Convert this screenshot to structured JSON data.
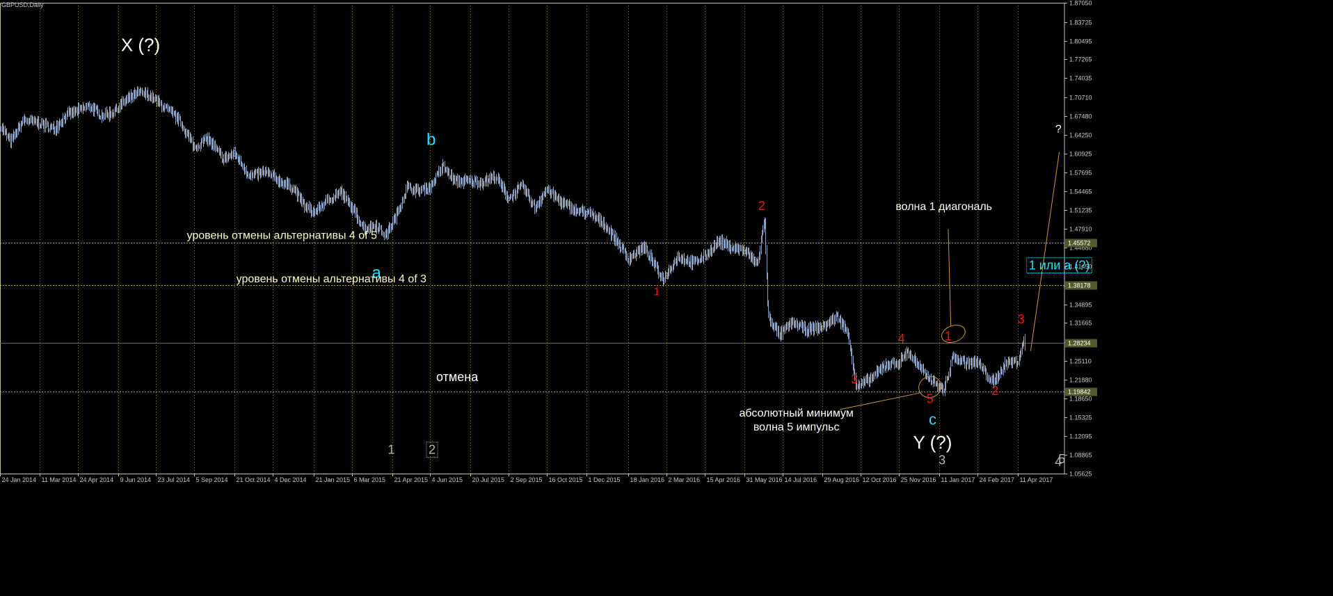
{
  "window": {
    "symbol_label": "GBPUSD,Daily"
  },
  "chart_data": {
    "type": "candlestick",
    "symbol": "GBPUSD",
    "timeframe": "Daily",
    "ylim": [
      1.05625,
      1.8705
    ],
    "xlim": [
      "2014-01-24",
      "2017-06-04"
    ],
    "y_ticks": [
      "1.87050",
      "1.83725",
      "1.80495",
      "1.77265",
      "1.74035",
      "1.70710",
      "1.67480",
      "1.64250",
      "1.60925",
      "1.57695",
      "1.54465",
      "1.51235",
      "1.47910",
      "1.44680",
      "1.41450",
      "1.38125",
      "1.34895",
      "1.31665",
      "1.28340",
      "1.25110",
      "1.21880",
      "1.18650",
      "1.15325",
      "1.12095",
      "1.08865",
      "1.05625"
    ],
    "x_ticks": [
      {
        "label": "24 Jan 2014",
        "date": "2014-01-24"
      },
      {
        "label": "11 Mar 2014",
        "date": "2014-03-11"
      },
      {
        "label": "24 Apr 2014",
        "date": "2014-04-24"
      },
      {
        "label": "9 Jun 2014",
        "date": "2014-06-09"
      },
      {
        "label": "23 Jul 2014",
        "date": "2014-07-23"
      },
      {
        "label": "5 Sep 2014",
        "date": "2014-09-05"
      },
      {
        "label": "21 Oct 2014",
        "date": "2014-10-21"
      },
      {
        "label": "4 Dec 2014",
        "date": "2014-12-04"
      },
      {
        "label": "21 Jan 2015",
        "date": "2015-01-21"
      },
      {
        "label": "6 Mar 2015",
        "date": "2015-03-06"
      },
      {
        "label": "21 Apr 2015",
        "date": "2015-04-21"
      },
      {
        "label": "4 Jun 2015",
        "date": "2015-06-04"
      },
      {
        "label": "20 Jul 2015",
        "date": "2015-07-20"
      },
      {
        "label": "2 Sep 2015",
        "date": "2015-09-02"
      },
      {
        "label": "16 Oct 2015",
        "date": "2015-10-16"
      },
      {
        "label": "1 Dec 2015",
        "date": "2015-12-01"
      },
      {
        "label": "18 Jan 2016",
        "date": "2016-01-18"
      },
      {
        "label": "2 Mar 2016",
        "date": "2016-03-02"
      },
      {
        "label": "15 Apr 2016",
        "date": "2016-04-15"
      },
      {
        "label": "31 May 2016",
        "date": "2016-05-31"
      },
      {
        "label": "14 Jul 2016",
        "date": "2016-07-14"
      },
      {
        "label": "29 Aug 2016",
        "date": "2016-08-29"
      },
      {
        "label": "12 Oct 2016",
        "date": "2016-10-12"
      },
      {
        "label": "25 Nov 2016",
        "date": "2016-11-25"
      },
      {
        "label": "11 Jan 2017",
        "date": "2017-01-11"
      },
      {
        "label": "24 Feb 2017",
        "date": "2017-02-24"
      },
      {
        "label": "11 Apr 2017",
        "date": "2017-04-11"
      }
    ],
    "series_path": [
      [
        "2014-01-24",
        1.658
      ],
      [
        "2014-02-05",
        1.63
      ],
      [
        "2014-02-20",
        1.668
      ],
      [
        "2014-03-11",
        1.662
      ],
      [
        "2014-03-27",
        1.652
      ],
      [
        "2014-04-10",
        1.676
      ],
      [
        "2014-04-24",
        1.684
      ],
      [
        "2014-05-07",
        1.692
      ],
      [
        "2014-05-20",
        1.676
      ],
      [
        "2014-06-02",
        1.68
      ],
      [
        "2014-06-18",
        1.702
      ],
      [
        "2014-07-03",
        1.715
      ],
      [
        "2014-07-15",
        1.71
      ],
      [
        "2014-08-01",
        1.69
      ],
      [
        "2014-08-18",
        1.668
      ],
      [
        "2014-09-05",
        1.62
      ],
      [
        "2014-09-20",
        1.636
      ],
      [
        "2014-10-08",
        1.6
      ],
      [
        "2014-10-21",
        1.61
      ],
      [
        "2014-11-08",
        1.57
      ],
      [
        "2014-11-25",
        1.578
      ],
      [
        "2014-12-10",
        1.564
      ],
      [
        "2014-12-28",
        1.55
      ],
      [
        "2015-01-10",
        1.518
      ],
      [
        "2015-01-21",
        1.508
      ],
      [
        "2015-02-05",
        1.528
      ],
      [
        "2015-02-20",
        1.544
      ],
      [
        "2015-03-06",
        1.514
      ],
      [
        "2015-03-20",
        1.48
      ],
      [
        "2015-04-02",
        1.486
      ],
      [
        "2015-04-13",
        1.468
      ],
      [
        "2015-04-25",
        1.5
      ],
      [
        "2015-05-08",
        1.552
      ],
      [
        "2015-05-20",
        1.545
      ],
      [
        "2015-06-04",
        1.552
      ],
      [
        "2015-06-18",
        1.588
      ],
      [
        "2015-07-02",
        1.562
      ],
      [
        "2015-07-20",
        1.562
      ],
      [
        "2015-08-01",
        1.56
      ],
      [
        "2015-08-18",
        1.57
      ],
      [
        "2015-09-02",
        1.532
      ],
      [
        "2015-09-18",
        1.554
      ],
      [
        "2015-10-02",
        1.516
      ],
      [
        "2015-10-16",
        1.548
      ],
      [
        "2015-11-01",
        1.526
      ],
      [
        "2015-11-20",
        1.51
      ],
      [
        "2015-12-01",
        1.508
      ],
      [
        "2015-12-20",
        1.49
      ],
      [
        "2016-01-05",
        1.458
      ],
      [
        "2016-01-18",
        1.428
      ],
      [
        "2016-02-05",
        1.448
      ],
      [
        "2016-02-27",
        1.392
      ],
      [
        "2016-03-15",
        1.432
      ],
      [
        "2016-04-01",
        1.42
      ],
      [
        "2016-04-15",
        1.432
      ],
      [
        "2016-05-01",
        1.458
      ],
      [
        "2016-05-15",
        1.448
      ],
      [
        "2016-05-31",
        1.442
      ],
      [
        "2016-06-15",
        1.418
      ],
      [
        "2016-06-23",
        1.5
      ],
      [
        "2016-06-27",
        1.33
      ],
      [
        "2016-07-10",
        1.295
      ],
      [
        "2016-07-25",
        1.318
      ],
      [
        "2016-08-10",
        1.305
      ],
      [
        "2016-08-29",
        1.31
      ],
      [
        "2016-09-15",
        1.328
      ],
      [
        "2016-09-28",
        1.296
      ],
      [
        "2016-10-07",
        1.205
      ],
      [
        "2016-10-25",
        1.222
      ],
      [
        "2016-11-10",
        1.245
      ],
      [
        "2016-11-25",
        1.248
      ],
      [
        "2016-12-05",
        1.268
      ],
      [
        "2016-12-20",
        1.236
      ],
      [
        "2016-12-30",
        1.222
      ],
      [
        "2017-01-16",
        1.2
      ],
      [
        "2017-01-26",
        1.258
      ],
      [
        "2017-02-10",
        1.248
      ],
      [
        "2017-02-24",
        1.248
      ],
      [
        "2017-03-14",
        1.212
      ],
      [
        "2017-03-28",
        1.248
      ],
      [
        "2017-04-11",
        1.25
      ],
      [
        "2017-04-18",
        1.285
      ],
      [
        "2017-04-20",
        1.278
      ]
    ],
    "horizontal_levels": [
      {
        "value": 1.45572,
        "label": "1.45572",
        "style": "dotted",
        "color": "#b8b840"
      },
      {
        "value": 1.38178,
        "label": "1.38178",
        "style": "dotted",
        "color": "#b8b840"
      },
      {
        "value": 1.28234,
        "label": "1.28234",
        "style": "solid",
        "color": "#6a6a6a"
      },
      {
        "value": 1.19842,
        "label": "1.19842",
        "style": "dotted",
        "color": "#b8b840"
      }
    ],
    "vertical_grid": "dotted",
    "colors": {
      "background": "#000000",
      "bars": "#8aa2c0",
      "grid": "#b8b840",
      "axis": "#c0c0c0",
      "wave_red": "#ff1010",
      "wave_cyan": "#22e0ff",
      "text_white": "#ffffff",
      "text_yellow": "#ffffc0",
      "text_gray": "#b4b4b4",
      "trendline": "#d09a3a",
      "price_tag": "#55582a"
    },
    "annotations": [
      {
        "id": "x-wave",
        "text": "X  (?)",
        "date": "2014-07-05",
        "value": 1.795,
        "color": "text_white",
        "size": 26
      },
      {
        "id": "b-wave",
        "text": "b",
        "date": "2015-06-05",
        "value": 1.632,
        "color": "wave_cyan",
        "size": 24
      },
      {
        "id": "a-wave",
        "text": "a",
        "date": "2015-04-03",
        "value": 1.402,
        "color": "wave_cyan",
        "size": 24
      },
      {
        "id": "level-4of5",
        "text": "уровень отмены альтернативы 4 of 5",
        "date": "2014-12-15",
        "value": 1.467,
        "color": "text_yellow",
        "size": 16
      },
      {
        "id": "level-4of3",
        "text": "уровень отмены альтернативы 4 of 3",
        "date": "2015-02-10",
        "value": 1.392,
        "color": "text_yellow",
        "size": 16
      },
      {
        "id": "otmena",
        "text": "отмена",
        "date": "2015-07-05",
        "value": 1.222,
        "color": "text_white",
        "size": 18
      },
      {
        "id": "red-1-main",
        "text": "1",
        "date": "2016-02-20",
        "value": 1.37,
        "color": "wave_red",
        "size": 16
      },
      {
        "id": "red-2-main",
        "text": "2",
        "date": "2016-06-20",
        "value": 1.518,
        "color": "wave_red",
        "size": 18
      },
      {
        "id": "red-3-low",
        "text": "3",
        "date": "2016-10-05",
        "value": 1.218,
        "color": "wave_red",
        "size": 18
      },
      {
        "id": "red-4",
        "text": "4",
        "date": "2016-11-28",
        "value": 1.288,
        "color": "wave_red",
        "size": 18
      },
      {
        "id": "red-5",
        "text": "5",
        "date": "2016-12-31",
        "value": 1.184,
        "color": "wave_red",
        "size": 18
      },
      {
        "id": "red-1-small",
        "text": "1",
        "date": "2017-01-21",
        "value": 1.292,
        "color": "wave_red",
        "size": 18
      },
      {
        "id": "red-2-small",
        "text": "2",
        "date": "2017-03-16",
        "value": 1.198,
        "color": "wave_red",
        "size": 18
      },
      {
        "id": "red-3-small",
        "text": "3",
        "date": "2017-04-15",
        "value": 1.322,
        "color": "wave_red",
        "size": 18
      },
      {
        "id": "c-wave",
        "text": "c",
        "date": "2017-01-03",
        "value": 1.148,
        "color": "wave_cyan",
        "size": 22
      },
      {
        "id": "y-wave",
        "text": "Y  (?)",
        "date": "2017-01-03",
        "value": 1.108,
        "color": "text_white",
        "size": 26
      },
      {
        "id": "abs-min-1",
        "text": "абсолютный минимум",
        "date": "2016-07-30",
        "value": 1.16,
        "color": "text_white",
        "size": 16
      },
      {
        "id": "abs-min-2",
        "text": "волна 5 импульс",
        "date": "2016-07-30",
        "value": 1.136,
        "color": "text_white",
        "size": 16
      },
      {
        "id": "diag-label",
        "text": "волна 1 диагональ",
        "date": "2017-01-16",
        "value": 1.517,
        "color": "text_white",
        "size": 16
      },
      {
        "id": "one-or-a",
        "text": "1 или а (?)",
        "date": "2017-05-29",
        "value": 1.415,
        "color": "wave_cyan",
        "size": 18,
        "boxed": true
      },
      {
        "id": "question",
        "text": "?",
        "date": "2017-05-28",
        "value": 1.651,
        "color": "text_white",
        "size": 16
      },
      {
        "id": "gray-1",
        "text": "1",
        "date": "2015-04-20",
        "value": 1.096,
        "color": "text_gray",
        "size": 18
      },
      {
        "id": "gray-2",
        "text": "2",
        "date": "2015-06-06",
        "value": 1.096,
        "color": "text_gray",
        "size": 18,
        "boxed": true
      },
      {
        "id": "gray-3",
        "text": "3",
        "date": "2017-01-14",
        "value": 1.078,
        "color": "text_gray",
        "size": 18
      },
      {
        "id": "gray-4",
        "text": "4",
        "date": "2017-05-28",
        "value": 1.075,
        "color": "text_gray",
        "size": 18
      },
      {
        "id": "gray-5",
        "text": "5",
        "date": "2017-06-01",
        "value": 1.08,
        "color": "text_gray",
        "size": 18
      }
    ],
    "ellipses": [
      {
        "id": "ellipse-1",
        "center": [
          "2017-01-27",
          1.298
        ],
        "rx_days": 14,
        "ry_value": 0.014,
        "color": "trendline"
      },
      {
        "id": "ellipse-5",
        "center": [
          "2016-12-31",
          1.206
        ],
        "rx_days": 13,
        "ry_value": 0.018,
        "color": "trendline"
      }
    ],
    "lines": [
      {
        "id": "trendline",
        "from": [
          "2017-04-26",
          1.268
        ],
        "to": [
          "2017-05-29",
          1.612
        ],
        "color": "trendline"
      },
      {
        "id": "leader-diag",
        "from": [
          "2017-01-21",
          1.479
        ],
        "to": [
          "2017-01-24",
          1.311
        ],
        "color": "trendline"
      },
      {
        "id": "leader-min",
        "from": [
          "2016-09-18",
          1.167
        ],
        "to": [
          "2016-12-20",
          1.196
        ],
        "color": "trendline"
      }
    ]
  }
}
